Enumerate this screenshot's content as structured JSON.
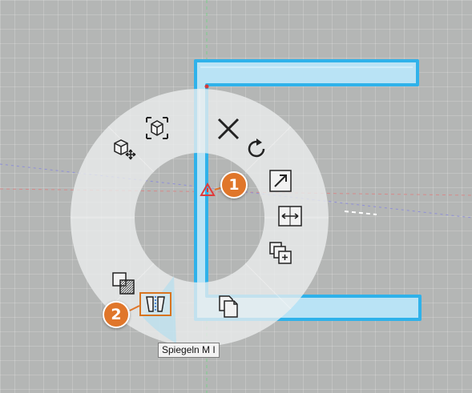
{
  "colors": {
    "background": "#b4b6b5",
    "wall_fill": "#b9e3f5",
    "wall_outline": "#2fb2ea",
    "callout": "#e0762a",
    "highlight_border": "#d8741f",
    "selection_marker": "#e03a3a"
  },
  "radial_menu": {
    "items": [
      {
        "name": "transform-3d-icon",
        "tooltip": ""
      },
      {
        "name": "move-3d-icon",
        "tooltip": ""
      },
      {
        "name": "delete-icon",
        "tooltip": ""
      },
      {
        "name": "rotate-icon",
        "tooltip": ""
      },
      {
        "name": "scale-icon",
        "tooltip": ""
      },
      {
        "name": "stretch-icon",
        "tooltip": ""
      },
      {
        "name": "copy-add-icon",
        "tooltip": ""
      },
      {
        "name": "paste-icon",
        "tooltip": ""
      },
      {
        "name": "hatch-icon",
        "tooltip": ""
      },
      {
        "name": "mirror-icon",
        "tooltip": "Spiegeln M I"
      }
    ],
    "active_tooltip": "Spiegeln M I"
  },
  "callouts": [
    {
      "label": "1"
    },
    {
      "label": "2"
    }
  ]
}
